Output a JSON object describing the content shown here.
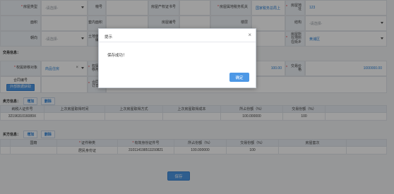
{
  "form": {
    "house_type": {
      "label": "房屋类型",
      "placeholder": "-请选择-"
    },
    "building_no": {
      "label": "幢号"
    },
    "property_cert": {
      "label": "房屋产权证书号"
    },
    "tax_office": {
      "label": "房屋属地税务机关",
      "value": "国家税务总局上"
    },
    "house_address": {
      "label": "房屋地址",
      "value": "123"
    },
    "area": {
      "label": "面积"
    },
    "inner_area": {
      "label": "套内面积"
    },
    "house_code": {
      "label": "房屋编号"
    },
    "floor": {
      "label": "楼层"
    },
    "structure": {
      "label": "结构",
      "placeholder": "-请选择-"
    },
    "orientation": {
      "label": "朝向",
      "placeholder": "-请选择-"
    },
    "land_use_no": {
      "label": "土地使用编号"
    },
    "district": {
      "label": "房屋所在地所在街乡",
      "value": "黄浦区"
    }
  },
  "transaction": {
    "title": "交易信息：",
    "transfer_obj": {
      "label": "权属转移对象",
      "value": "商品住房"
    },
    "transfer_use": {
      "label": "权属转移用途"
    },
    "ratio": {
      "value": "100.00"
    },
    "price": {
      "label": "交易价格",
      "value": "1000000.00"
    },
    "contract_no": {
      "label": "合同编号"
    },
    "contract_date": {
      "label": "合同签订日期"
    },
    "external_btn": "外部数据获取"
  },
  "seller": {
    "title": "卖方信息：",
    "add": "增加",
    "del": "删除",
    "headers": [
      "纳税人证件号",
      "上次房屋取得时间",
      "上次房屋取得方式",
      "上次房屋取得成本",
      "所占份额（%）",
      "交易份额（%）"
    ],
    "rows": [
      [
        "3219631016089X",
        "",
        "",
        "",
        "100.000000",
        "100"
      ]
    ]
  },
  "buyer": {
    "title": "买方信息：",
    "add": "增加",
    "del": "删除",
    "headers": [
      "国籍",
      "证件种类",
      "有效身份证件号",
      "所占份额（%）",
      "交易份额（%）",
      "房屋套次"
    ],
    "rows": [
      [
        "",
        "居民身份证",
        "310114198511150821",
        "100.000000",
        "100",
        ""
      ]
    ]
  },
  "save_label": "保存",
  "modal": {
    "title": "提示",
    "message": "保存成功！",
    "ok": "确定",
    "close": "×"
  }
}
